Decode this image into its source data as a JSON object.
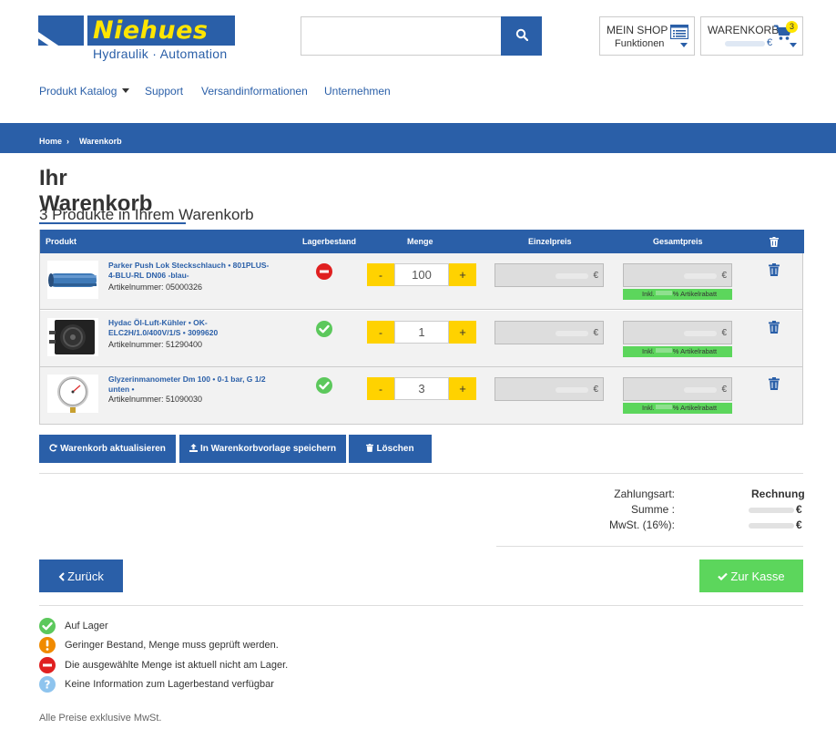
{
  "brand": {
    "name": "Niehues",
    "subtitle": "Hydraulik · Automation"
  },
  "search": {
    "placeholder": ""
  },
  "header": {
    "shop_title": "MEIN SHOP",
    "shop_sub": "Funktionen",
    "cart_title": "WARENKORB",
    "cart_badge": "3",
    "cart_currency": "€"
  },
  "nav": {
    "items": [
      {
        "label": "Produkt Katalog"
      },
      {
        "label": "Support"
      },
      {
        "label": "Versandinformationen"
      },
      {
        "label": "Unternehmen"
      }
    ]
  },
  "breadcrumb": {
    "home": "Home",
    "sep": "›",
    "current": "Warenkorb"
  },
  "page": {
    "title": "Ihr Warenkorb",
    "subtitle": "3 Produkte in Ihrem Warenkorb"
  },
  "table": {
    "headers": {
      "product": "Produkt",
      "stock": "Lagerbestand",
      "qty": "Menge",
      "unit_price": "Einzelpreis",
      "total_price": "Gesamtpreis"
    },
    "currency": "€",
    "rabatt_left": "Inkl.",
    "rabatt_right": "% Artikelrabatt",
    "rows": [
      {
        "name": "Parker Push Lok Steckschlauch • 801PLUS-4-BLU-RL DN06 -blau-",
        "article": "Artikelnummer: 05000326",
        "stock": "out",
        "qty": "100",
        "minus": "-",
        "plus": "+"
      },
      {
        "name": "Hydac Öl-Luft-Kühler • OK-ELC2H/1.0/400V/1/S • 3099620",
        "article": "Artikelnummer: 51290400",
        "stock": "in",
        "qty": "1",
        "minus": "-",
        "plus": "+"
      },
      {
        "name": "Glyzerinmanometer Dm 100 • 0-1 bar, G 1/2 unten •",
        "article": "Artikelnummer: 51090030",
        "stock": "in",
        "qty": "3",
        "minus": "-",
        "plus": "+"
      }
    ]
  },
  "actions": {
    "update": "Warenkorb aktualisieren",
    "save_template": "In Warenkorbvorlage speichern",
    "delete": "Löschen"
  },
  "summary": {
    "payment_label": "Zahlungsart:",
    "payment_value": "Rechnung",
    "sum_label": "Summe :",
    "vat_label": "MwSt. (16%):",
    "currency": "€"
  },
  "nav_buttons": {
    "back": "Zurück",
    "checkout": "Zur Kasse"
  },
  "legend": [
    {
      "icon": "check",
      "color": "#5cc85c",
      "text": "Auf Lager"
    },
    {
      "icon": "exclamation",
      "color": "#f08a00",
      "text": "Geringer Bestand, Menge muss geprüft werden."
    },
    {
      "icon": "minus",
      "color": "#e02020",
      "text": "Die ausgewählte Menge ist aktuell nicht am Lager."
    },
    {
      "icon": "question",
      "color": "#8ec4ee",
      "text": "Keine Information zum Lagerbestand verfügbar"
    }
  ],
  "footnote": "Alle Preise exklusive MwSt.",
  "colors": {
    "primary": "#2a5fa8",
    "accent_yellow": "#ffd200",
    "success": "#5cd65c"
  }
}
